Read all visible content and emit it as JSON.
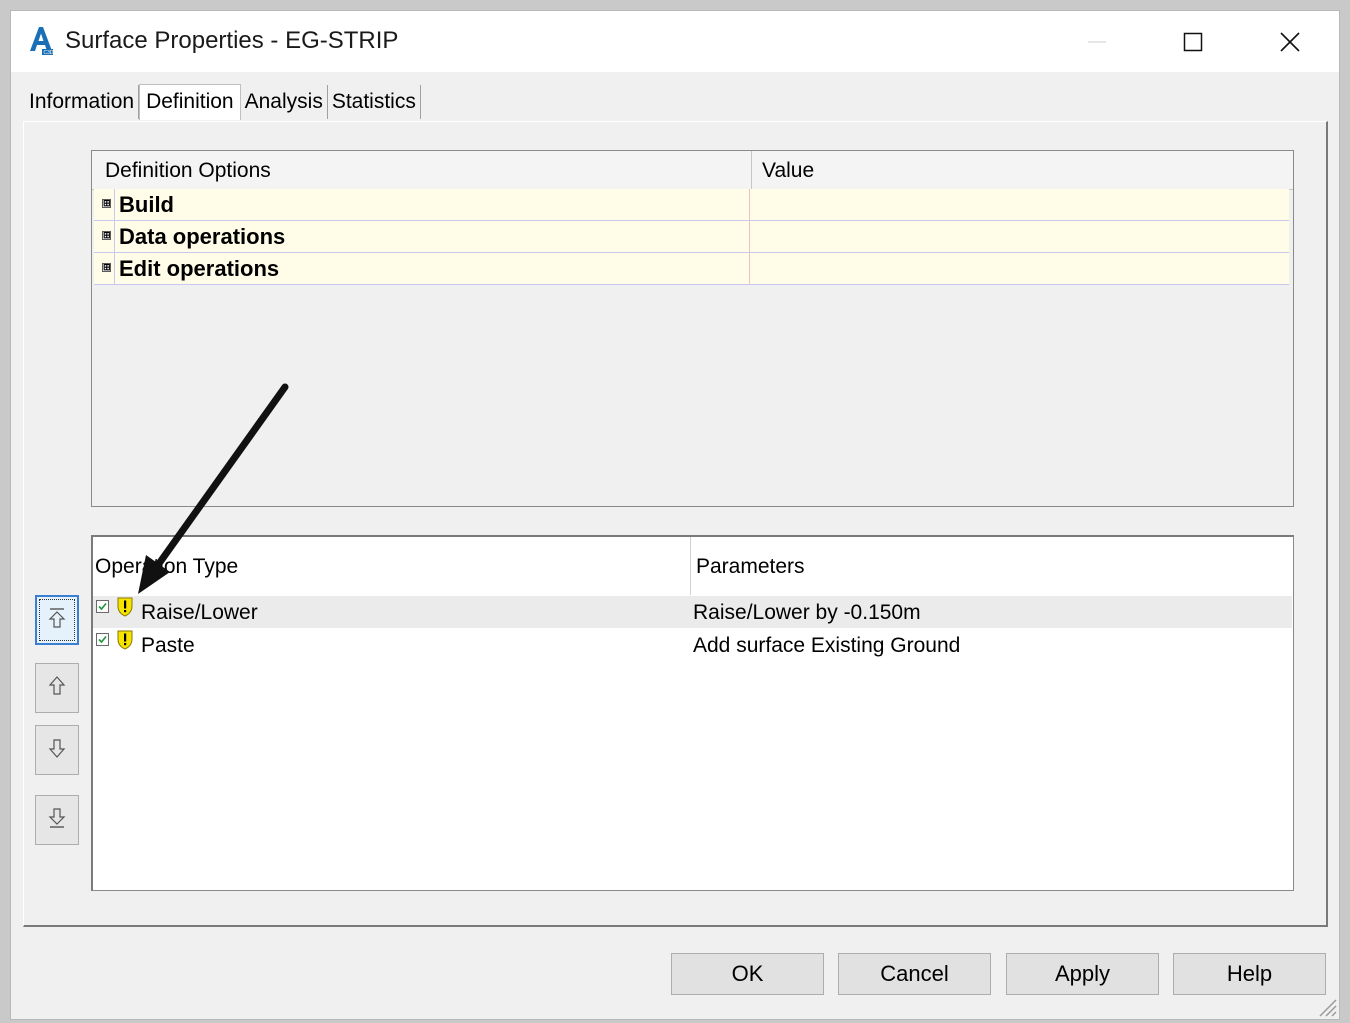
{
  "window": {
    "title": "Surface Properties - EG-STRIP",
    "app_icon": "civil3d-icon",
    "controls": [
      "minimize-icon",
      "maximize-icon",
      "close-icon"
    ]
  },
  "tabs": [
    {
      "label": "Information",
      "active": false
    },
    {
      "label": "Definition",
      "active": true
    },
    {
      "label": "Analysis",
      "active": false
    },
    {
      "label": "Statistics",
      "active": false
    }
  ],
  "definition_grid": {
    "headers": {
      "option": "Definition Options",
      "value": "Value"
    },
    "rows": [
      {
        "expander": "⊞",
        "label": "Build",
        "value": ""
      },
      {
        "expander": "⊞",
        "label": "Data operations",
        "value": ""
      },
      {
        "expander": "⊞",
        "label": "Edit operations",
        "value": ""
      }
    ]
  },
  "operations_grid": {
    "headers": {
      "type": "Operation Type",
      "params": "Parameters"
    },
    "rows": [
      {
        "checked": true,
        "icon": "warning-icon",
        "type": "Raise/Lower",
        "params": "Raise/Lower by -0.150m",
        "selected": true
      },
      {
        "checked": true,
        "icon": "warning-icon",
        "type": "Paste",
        "params": "Add surface Existing Ground",
        "selected": false
      }
    ]
  },
  "side_buttons": [
    "move-to-top-icon",
    "move-up-icon",
    "move-down-icon",
    "move-to-bottom-icon"
  ],
  "buttons": {
    "ok": "OK",
    "cancel": "Cancel",
    "apply": "Apply",
    "help": "Help"
  },
  "colors": {
    "property_row_bg": "#fffde8",
    "selection_bg": "#ebebeb",
    "focus_border": "#3c7fd1",
    "warning_yellow": "#f5e400"
  }
}
